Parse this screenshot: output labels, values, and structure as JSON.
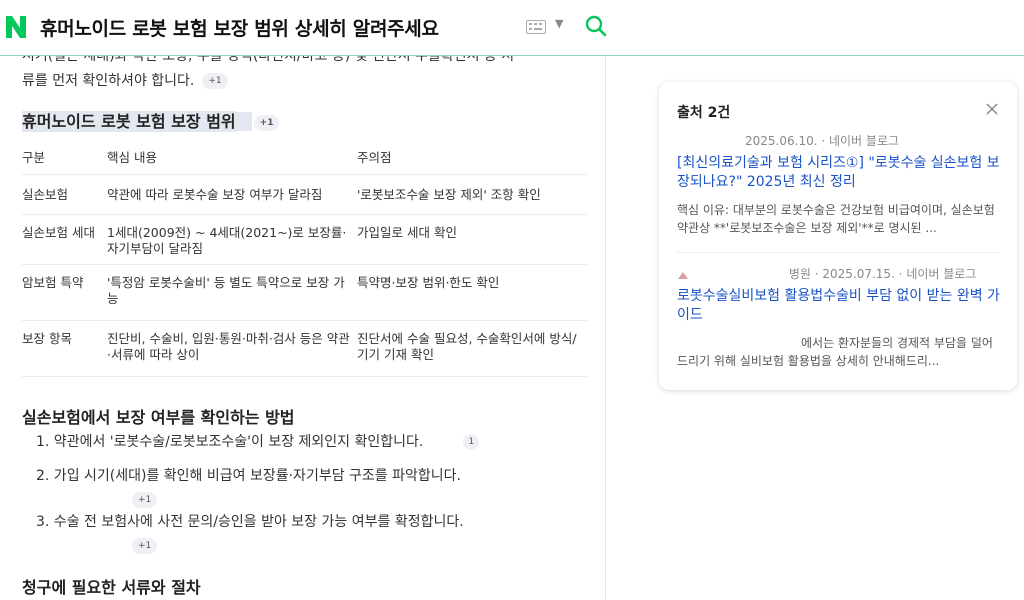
{
  "header": {
    "title": "휴머노이드 로봇 보험 보장 범위 상세히 알려주세요",
    "colors": {
      "brand": "#03c75a",
      "divider": "#8fd8b4"
    }
  },
  "intro": {
    "line1": "시기(실손 세대)와 약관 조항, 수술 방식(다빈치/마코 등) 및 진단서·수술확인서 등 서",
    "line2": "류를 먼저 확인하셔야 합니다.",
    "badge": "+1"
  },
  "section1": {
    "title": "휴머노이드 로봇 보험 보장 범위",
    "badge": "+1"
  },
  "table": {
    "headers": [
      "구분",
      "핵심 내용",
      "주의점"
    ],
    "rows": [
      [
        "실손보험",
        "약관에 따라 로봇수술 보장 여부가 달라짐",
        "'로봇보조수술 보장 제외' 조항 확인"
      ],
      [
        "실손보험 세대",
        "1세대(2009전) ~ 4세대(2021~)로 보장률·자기부담이 달라짐",
        "가입일로 세대 확인"
      ],
      [
        "암보험 특약",
        "'특정암 로봇수술비' 등 별도 특약으로 보장 가능",
        "특약명·보장 범위·한도 확인"
      ],
      [
        "보장 항목",
        "진단비, 수술비, 입원·통원·마취·검사 등은 약관·서류에 따라 상이",
        "진단서에 수술 필요성, 수술확인서에 방식/기기 기재 확인"
      ]
    ]
  },
  "section2": {
    "title": "실손보험에서 보장 여부를 확인하는 방법",
    "steps": [
      {
        "text": "1. 약관에서 '로봇수술/로봇보조수술'이 보장 제외인지 확인합니다.",
        "badge": "1"
      },
      {
        "text": "2. 가입 시기(세대)를 확인해 비급여 보장률·자기부담 구조를 파악합니다.",
        "badge": "+1"
      },
      {
        "text": "3. 수술 전 보험사에 사전 문의/승인을 받아 보장 가능 여부를 확정합니다.",
        "badge": "+1"
      }
    ]
  },
  "section3": {
    "title": "청구에 필요한 서류와 절차"
  },
  "panel": {
    "title": "출처 2건",
    "sources": [
      {
        "meta": "2025.06.10. · 네이버 블로그",
        "link": "[최신의료기술과 보험 시리즈①] \"로봇수술 실손보험 보장되나요?\" 2025년 최신 정리",
        "desc": "핵심 이유: 대부분의 로봇수술은 건강보험 비급여이며, 실손보험 약관상 **'로봇보조수술은 보장 제외'**로 명시된 ..."
      },
      {
        "meta": "병원 · 2025.07.15. · 네이버 블로그",
        "link": "로봇수술실비보험 활용법수술비 부담 없이 받는 완벽 가이드",
        "desc": "에서는 환자분들의 경제적 부담을 덜어드리기 위해 실비보험 활용법을 상세히 안내해드리..."
      }
    ]
  }
}
